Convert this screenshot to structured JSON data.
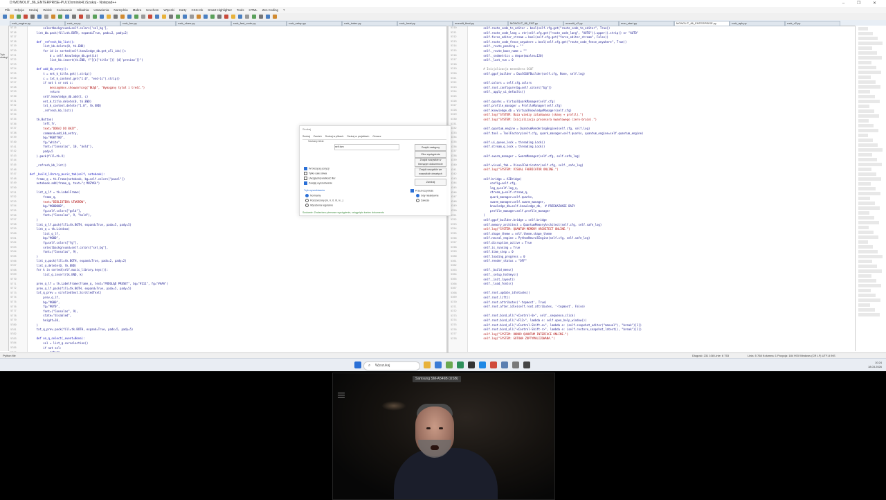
{
  "window": {
    "title": "D:\\MONOLIT_86_ENTERPRISE-PUL\\Dominik4L\\Szukaj - Notepad++",
    "buttons": "–  ❐  ✕"
  },
  "menu": [
    "Plik",
    "Edycja",
    "Szukaj",
    "Widok",
    "Kodowanie",
    "Składnia",
    "Ustawienia",
    "Narzędzia",
    "Makra",
    "Uruchom",
    "Wtyczki",
    "Karty",
    "CSS-Ink",
    "Smart Highlighter",
    "Tools",
    "HTML",
    "Zen Coding",
    "?"
  ],
  "tabs": [
    "rock_engine.py",
    "rock_cu.py",
    "rock_fun.py",
    "rock_clues.py",
    "rock_fast_code.py",
    "rock_setup.py",
    "rock_index.py",
    "rock_heat.py",
    "monolit_final.py",
    "MONOLIT_86_ENT.py",
    "monolit_v2.py",
    "mon_start.py",
    "MONOLIT_86_ENTERPRISE.py",
    "rock_apk.py",
    "rock_v2.py"
  ],
  "left_strip_text": "Tryb obsługi",
  "left_code": [
    {
      "n": "5715",
      "t": "        selectbackground=self.colors['sel_bg'],",
      "c": ""
    },
    {
      "n": "5716",
      "t": "    list_bb.pack(fill=tk.BOTH, expand=True, padx=2, pady=2)",
      "c": ""
    },
    {
      "n": "5717",
      "t": "",
      "c": ""
    },
    {
      "n": "5718",
      "t": "    def _refresh_kb_list():",
      "c": "blue"
    },
    {
      "n": "5719",
      "t": "        list_kb.delete(0, tk.END)",
      "c": ""
    },
    {
      "n": "5720",
      "t": "        for id in sorted(self.knowledge_db.get_all_ids()):",
      "c": ""
    },
    {
      "n": "5721",
      "t": "            d = self.knowledge_db.get(id)",
      "c": ""
    },
    {
      "n": "5722",
      "t": "            list_kb.insert(tk.END, f\"[{d['title']}] {d['preview']}\")",
      "c": ""
    },
    {
      "n": "5723",
      "t": "",
      "c": ""
    },
    {
      "n": "5724",
      "t": "    def add_kb_entry():",
      "c": "blue"
    },
    {
      "n": "5725",
      "t": "        t = ent_k_title.get().strip()",
      "c": ""
    },
    {
      "n": "5726",
      "t": "        c = txt_k_content.get(\"1.0\", \"end-1c\").strip()",
      "c": ""
    },
    {
      "n": "5727",
      "t": "        if not t or not c:",
      "c": ""
    },
    {
      "n": "5728",
      "t": "            messagebox.showwarning(\"BŁĄD\", \"Wymagany tytuł i treść.\")",
      "c": "red"
    },
    {
      "n": "5729",
      "t": "            return",
      "c": ""
    },
    {
      "n": "5730",
      "t": "        self.knowledge_db.add(t, c)",
      "c": ""
    },
    {
      "n": "5731",
      "t": "        ent_k_title.delete(0, tk.END)",
      "c": ""
    },
    {
      "n": "5732",
      "t": "        txt_k_content.delete(\"1.0\", tk.END)",
      "c": ""
    },
    {
      "n": "5733",
      "t": "        _refresh_kb_list()",
      "c": ""
    },
    {
      "n": "5734",
      "t": "",
      "c": ""
    },
    {
      "n": "5735",
      "t": "    tk.Button(",
      "c": ""
    },
    {
      "n": "5736",
      "t": "        left_fr,",
      "c": ""
    },
    {
      "n": "5737",
      "t": "        text=\"DODAJ DO BAZY\",",
      "c": "red"
    },
    {
      "n": "5738",
      "t": "        command=add_kb_entry,",
      "c": ""
    },
    {
      "n": "5739",
      "t": "        bg=\"#00ff00\",",
      "c": ""
    },
    {
      "n": "5740",
      "t": "        fg=\"white\",",
      "c": ""
    },
    {
      "n": "5741",
      "t": "        font=(\"Consolas\", 10, \"bold\"),",
      "c": ""
    },
    {
      "n": "5742",
      "t": "        pady=5",
      "c": ""
    },
    {
      "n": "5743",
      "t": "    ).pack(fill=tk.X)",
      "c": ""
    },
    {
      "n": "5744",
      "t": "",
      "c": ""
    },
    {
      "n": "5745",
      "t": "    _refresh_kb_list()",
      "c": ""
    },
    {
      "n": "5746",
      "t": "",
      "c": ""
    },
    {
      "n": "5747",
      "t": "def _build_library_music_tab(self, notebook):",
      "c": "blue"
    },
    {
      "n": "5748",
      "t": "    frame_q = tk.Frame(notebook, bg=self.colors[\"panel\"])",
      "c": ""
    },
    {
      "n": "5749",
      "t": "    notebook.add(frame_q, text=\"♫ MUZYKA\")",
      "c": ""
    },
    {
      "n": "5750",
      "t": "",
      "c": ""
    },
    {
      "n": "5751",
      "t": "    list_q_lf = tk.LabelFrame(",
      "c": ""
    },
    {
      "n": "5752",
      "t": "        frame_q,",
      "c": ""
    },
    {
      "n": "5753",
      "t": "        text=\"BIBLIOTEKA UTWORÓW\",",
      "c": "red"
    },
    {
      "n": "5754",
      "t": "        bg=\"#000000\",",
      "c": ""
    },
    {
      "n": "5755",
      "t": "        fg=self.colors[\"gold\"],",
      "c": ""
    },
    {
      "n": "5756",
      "t": "        font=(\"Consolas\", 9, \"bold\"),",
      "c": ""
    },
    {
      "n": "5757",
      "t": "    )",
      "c": ""
    },
    {
      "n": "5758",
      "t": "    list_q_lf.pack(fill=tk.BOTH, expand=True, padx=5, pady=5)",
      "c": ""
    },
    {
      "n": "5759",
      "t": "    list_q = tk.Listbox(",
      "c": ""
    },
    {
      "n": "5760",
      "t": "        list_q_lf,",
      "c": ""
    },
    {
      "n": "5761",
      "t": "        bg=\"#000\",",
      "c": ""
    },
    {
      "n": "5762",
      "t": "        fg=self.colors[\"fg\"],",
      "c": ""
    },
    {
      "n": "5763",
      "t": "        selectbackground=self.colors[\"sel_bg\"],",
      "c": ""
    },
    {
      "n": "5764",
      "t": "        font=(\"Consolas\", 9),",
      "c": ""
    },
    {
      "n": "5765",
      "t": "    )",
      "c": ""
    },
    {
      "n": "5766",
      "t": "    list_q.pack(fill=tk.BOTH, expand=True, padx=2, pady=2)",
      "c": ""
    },
    {
      "n": "5767",
      "t": "    list_q.delete(0, tk.END)",
      "c": ""
    },
    {
      "n": "5768",
      "t": "    for k in sorted(self.music_library.keys()):",
      "c": ""
    },
    {
      "n": "5769",
      "t": "        list_q.insert(tk.END, k)",
      "c": ""
    },
    {
      "n": "5770",
      "t": "",
      "c": ""
    },
    {
      "n": "5771",
      "t": "    prev_q_lf = tk.LabelFrame(frame_q, text=\"PODGLĄD PRESET\", bg=\"#111\", fg=\"#AAA\")",
      "c": ""
    },
    {
      "n": "5772",
      "t": "    prev_q_lf.pack(fill=tk.BOTH, expand=True, padx=5, pady=5)",
      "c": ""
    },
    {
      "n": "5773",
      "t": "    txt_q_prev = scrolledtext.ScrolledText(",
      "c": ""
    },
    {
      "n": "5774",
      "t": "        prev_q_lf,",
      "c": ""
    },
    {
      "n": "5775",
      "t": "        bg=\"#000\",",
      "c": ""
    },
    {
      "n": "5776",
      "t": "        fg=\"#0f0\",",
      "c": ""
    },
    {
      "n": "5777",
      "t": "        font=(\"Consolas\", 9),",
      "c": ""
    },
    {
      "n": "5778",
      "t": "        state=\"disabled\",",
      "c": ""
    },
    {
      "n": "5779",
      "t": "        height=10,",
      "c": ""
    },
    {
      "n": "5780",
      "t": "    )",
      "c": ""
    },
    {
      "n": "5781",
      "t": "    txt_q_prev.pack(fill=tk.BOTH, expand=True, padx=5, pady=5)",
      "c": ""
    },
    {
      "n": "5782",
      "t": "",
      "c": ""
    },
    {
      "n": "5783",
      "t": "    def on_q_select(_event=None):",
      "c": "blue"
    },
    {
      "n": "5784",
      "t": "        sel = list_q.curselection()",
      "c": ""
    },
    {
      "n": "5785",
      "t": "        if not sel:",
      "c": ""
    },
    {
      "n": "5786",
      "t": "            return",
      "c": ""
    }
  ],
  "right_code": [
    {
      "n": "5310",
      "t": "        self.route_code_to_editor = bool(self.cfg.get(\"route_code_to_editor\", True))",
      "c": ""
    },
    {
      "n": "5311",
      "t": "        self.route_code_lang = str(self.cfg.get(\"route_code_lang\", \"AUTO\")).upper().strip() or \"AUTO\"",
      "c": ""
    },
    {
      "n": "5312",
      "t": "        self.force_editor_stream = bool(self.cfg.get(\"force_editor_stream\", False))",
      "c": ""
    },
    {
      "n": "5313",
      "t": "        self.route_code_fence_anywhere = bool(self.cfg.get(\"route_code_fence_anywhere\", True))",
      "c": ""
    },
    {
      "n": "5314",
      "t": "        self._route_pending = \"\"",
      "c": ""
    },
    {
      "n": "5315",
      "t": "        self._route_base_name = \"\"",
      "c": ""
    },
    {
      "n": "5316",
      "t": "        self._sndmetrics = deque(maxlen=120)",
      "c": ""
    },
    {
      "n": "5317",
      "t": "        self._last_run = 0",
      "c": ""
    },
    {
      "n": "5318",
      "t": "",
      "c": ""
    },
    {
      "n": "5319",
      "t": "        # Inicjalizacja menedżera GGUF",
      "c": "grey"
    },
    {
      "n": "5320",
      "t": "        self.gguf_builder = DualGGUFBuilder(self.cfg, None, self.log)",
      "c": ""
    },
    {
      "n": "5321",
      "t": "",
      "c": ""
    },
    {
      "n": "5322",
      "t": "        self.colors = self.cfg.colors",
      "c": ""
    },
    {
      "n": "5323",
      "t": "        self.root.configure(bg=self.colors[\"bg\"])",
      "c": ""
    },
    {
      "n": "5324",
      "t": "        self._apply_ui_defaults()",
      "c": ""
    },
    {
      "n": "5325",
      "t": "",
      "c": ""
    },
    {
      "n": "5326",
      "t": "        self.quarks = VirtualQuarkManager(self.cfg)",
      "c": ""
    },
    {
      "n": "5327",
      "t": "        self.profile_manager = ProfileManager(self.cfg)",
      "c": ""
    },
    {
      "n": "5328",
      "t": "        self.knowledge_db = VirtualKnowledgeManager(self.cfg)",
      "c": ""
    },
    {
      "n": "5329",
      "t": "        self.log(\"SYSTEM: Baza wiedzy zaladowana (skany + profil).\")",
      "c": "red"
    },
    {
      "n": "5330",
      "t": "        self.log(\"SYSTEM: Inicjalizacja procesora kwantowego (zero-brain).\")",
      "c": "red"
    },
    {
      "n": "5331",
      "t": "",
      "c": ""
    },
    {
      "n": "5332",
      "t": "        self.quantum_engine = QuantumRenderingEngine(self.cfg, self.log)",
      "c": ""
    },
    {
      "n": "5333",
      "t": "        self.tool = ToolFactory(self.cfg, quark_manager=self.quarks, quantum_engine=self.quantum_engine)",
      "c": ""
    },
    {
      "n": "5334",
      "t": "",
      "c": ""
    },
    {
      "n": "5335",
      "t": "        self.ui_queue_lock = threading.Lock()",
      "c": ""
    },
    {
      "n": "5336",
      "t": "        self.stream_q_lock = threading.Lock()",
      "c": ""
    },
    {
      "n": "5337",
      "t": "",
      "c": ""
    },
    {
      "n": "5338",
      "t": "        self.swarm_manager = SwarmManager(self.cfg, self.safe_log)",
      "c": ""
    },
    {
      "n": "5339",
      "t": "",
      "c": ""
    },
    {
      "n": "5340",
      "t": "        self.visual_fab = VisualFabricator(self.cfg, self._safe_log)",
      "c": ""
    },
    {
      "n": "5341",
      "t": "        self.log(\"SYSTEM: VISUAL FABRICATOR ONLINE.\")",
      "c": "red"
    },
    {
      "n": "5342",
      "t": "",
      "c": ""
    },
    {
      "n": "5343",
      "t": "        self.bridge = AIBridge(",
      "c": ""
    },
    {
      "n": "5344",
      "t": "            config=self.cfg,",
      "c": ""
    },
    {
      "n": "5345",
      "t": "            log_q=self.log_q,",
      "c": ""
    },
    {
      "n": "5346",
      "t": "            stream_q=self.stream_q,",
      "c": ""
    },
    {
      "n": "5347",
      "t": "            quark_manager=self.quarks,",
      "c": ""
    },
    {
      "n": "5348",
      "t": "            swarm_manager=self.swarm_manager,",
      "c": ""
    },
    {
      "n": "5349",
      "t": "            knowledge_db=self.knowledge_db,  # PRZEKAZANIE BAZY",
      "c": ""
    },
    {
      "n": "5350",
      "t": "            profile_manager=self.profile_manager",
      "c": ""
    },
    {
      "n": "5351",
      "t": "        )",
      "c": ""
    },
    {
      "n": "5352",
      "t": "        self.gguf_builder.bridge = self.bridge",
      "c": ""
    },
    {
      "n": "5353",
      "t": "        self.memory_architect = QuantumMemoryArchitect(self.cfg, self.safe_log)",
      "c": ""
    },
    {
      "n": "5354",
      "t": "        self.log(\"SYSTEM: QUANTUM MEMORY ARCHITECT ONLINE.\")",
      "c": "red"
    },
    {
      "n": "5355",
      "t": "        self.shape_theme = self.theme.shape_theme",
      "c": ""
    },
    {
      "n": "5356",
      "t": "        self.neural_engine = PythonNeuralEngine(self.cfg, self.safe_log)",
      "c": ""
    },
    {
      "n": "5357",
      "t": "        self.disruption_active = True",
      "c": ""
    },
    {
      "n": "5358",
      "t": "        self.is_running = True",
      "c": ""
    },
    {
      "n": "5359",
      "t": "        self.time_step = 0",
      "c": ""
    },
    {
      "n": "5360",
      "t": "        self.loading_progress = 0",
      "c": ""
    },
    {
      "n": "5361",
      "t": "        self.render_status = \"OFF\"",
      "c": ""
    },
    {
      "n": "5362",
      "t": "",
      "c": ""
    },
    {
      "n": "5363",
      "t": "        self._build_menu()",
      "c": ""
    },
    {
      "n": "5364",
      "t": "        self._setup_hotkeys()",
      "c": ""
    },
    {
      "n": "5365",
      "t": "        self._init_layout()",
      "c": ""
    },
    {
      "n": "5366",
      "t": "        self._load_fonts()",
      "c": ""
    },
    {
      "n": "5367",
      "t": "",
      "c": ""
    },
    {
      "n": "5368",
      "t": "        self.root.update_idletasks()",
      "c": ""
    },
    {
      "n": "5369",
      "t": "        self.root.lift()",
      "c": ""
    },
    {
      "n": "5370",
      "t": "        self.root.attributes('-topmost', True)",
      "c": ""
    },
    {
      "n": "5371",
      "t": "        self.root.after_idle(self.root.attributes, '-topmost', False)",
      "c": ""
    },
    {
      "n": "5372",
      "t": "",
      "c": ""
    },
    {
      "n": "5373",
      "t": "        self.root.bind_all(\"<Control-0>\", self._sequence_click)",
      "c": ""
    },
    {
      "n": "5374",
      "t": "        self.root.bind_all(\"<F12>\", lambda e: self.open_help_window())",
      "c": ""
    },
    {
      "n": "5375",
      "t": "        self.root.bind_all(\"<Control-Shift-e>\", lambda e: (self.snapshot_editor(\"manual\"), \"break\")[1])",
      "c": ""
    },
    {
      "n": "5376",
      "t": "        self.root.bind_all(\"<Control-Shift-r>\", lambda e: (self.restore_snapshot_latest(), \"break\")[1])",
      "c": ""
    },
    {
      "n": "5377",
      "t": "        self.log(\"SYSTEM: OKNO9 QUANTUM INTERFACE ONLINE.\")",
      "c": "red"
    },
    {
      "n": "5378",
      "t": "        self.log(\"SYSTEM: GOTOWA ZOPTYMALIZOWANA.\")",
      "c": "red"
    }
  ],
  "dialog": {
    "title": "Szukaj",
    "tabs": [
      "Szukaj",
      "Zamień",
      "Szukaj w plikach",
      "Szukaj w projektach",
      "Oznacz"
    ],
    "field_label": "Szukany tekst:",
    "field_value": "self.fam",
    "btn_next": "Znajdź następny",
    "btn_count": "Zlicz wystąpienia",
    "btn_all_current": "Znajdź wszystkie w bieżącym dokumencie",
    "btn_all_open": "Znajdź wszystkie we wszystkich otwartych",
    "btn_close": "Zamknij",
    "opts": [
      "W bieżącej pozycji",
      "Tylko całe słowa",
      "Uwzględnij wielkość liter",
      "Zawijaj wyszukiwanie"
    ],
    "mode_label": "Tryb wyszukiwania",
    "modes": [
      "Normalny",
      "Rozszerzony (\\n, \\r, \\t, \\0, \\x...)",
      "Wyrażenia regularne"
    ],
    "transparency": "Przezroczystość",
    "trans_opts": [
      "Gdy nieaktywne",
      "Zawsze"
    ],
    "status": "Szukanie: Znaleziono pierwsze wystąpienie, osiągnięto koniec dokumentu"
  },
  "statusbar": {
    "left": "Python file",
    "mid": "Długość: 231 108   Linie: 6 753",
    "right": "Linia: 5 768   Kolumna: 1   Pozycja: 184 993     Windows (CR LF)     UTF-8     INS"
  },
  "taskbar": {
    "search_placeholder": "Wyszukaj",
    "time": "10:24",
    "date": "18.03.2026"
  },
  "webcam": {
    "title": "Samsung SM-A546B (USB)"
  }
}
